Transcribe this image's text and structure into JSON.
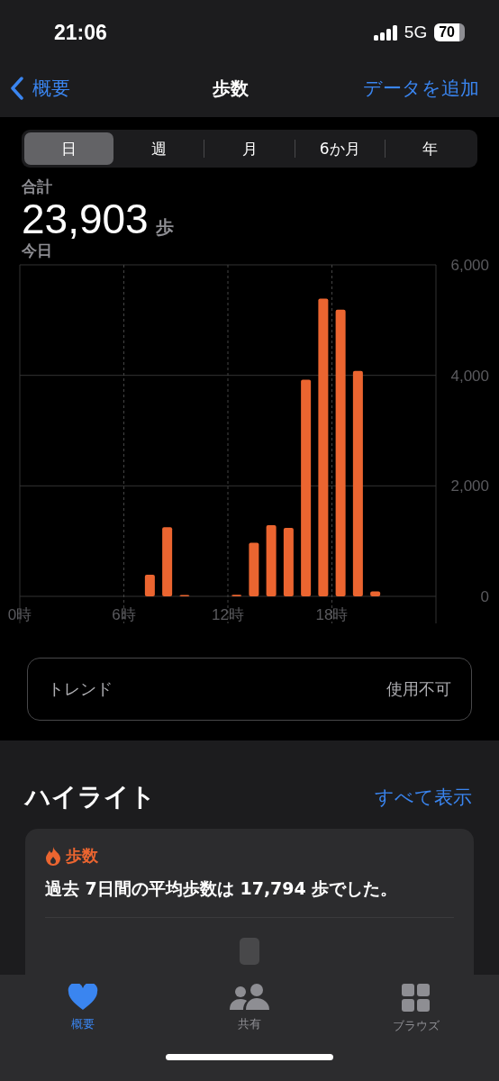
{
  "status_bar": {
    "time": "21:06",
    "network": "5G",
    "battery": "70"
  },
  "nav": {
    "back": "概要",
    "title": "歩数",
    "action": "データを追加"
  },
  "segments": [
    {
      "label": "日",
      "selected": true
    },
    {
      "label": "週",
      "selected": false
    },
    {
      "label": "月",
      "selected": false
    },
    {
      "label": "6か月",
      "selected": false
    },
    {
      "label": "年",
      "selected": false
    }
  ],
  "summary": {
    "label": "合計",
    "value": "23,903",
    "unit": "歩",
    "period": "今日"
  },
  "chart_data": {
    "type": "bar",
    "x": [
      7.5,
      8.5,
      9.5,
      12.5,
      13.5,
      14.5,
      15.5,
      16.5,
      17.5,
      18.5,
      19.5,
      20.5
    ],
    "xlim": [
      0,
      24
    ],
    "grid": true,
    "series": [
      {
        "color": "#eb6530",
        "values": [
          390,
          1250,
          10,
          30,
          970,
          1290,
          1240,
          3920,
          5390,
          5190,
          4080,
          90
        ]
      }
    ],
    "xticks": [
      {
        "value": 0,
        "label": "0時"
      },
      {
        "value": 6,
        "label": "6時"
      },
      {
        "value": 12,
        "label": "12時"
      },
      {
        "value": 18,
        "label": "18時"
      }
    ],
    "ylim": [
      0,
      6000
    ],
    "yticks": [
      {
        "value": 0,
        "label": "0"
      },
      {
        "value": 2000,
        "label": "2,000"
      },
      {
        "value": 4000,
        "label": "4,000"
      },
      {
        "value": 6000,
        "label": "6,000"
      }
    ]
  },
  "trend": {
    "label": "トレンド",
    "value": "使用不可"
  },
  "highlights": {
    "title": "ハイライト",
    "link": "すべて表示",
    "card": {
      "category": "歩数",
      "text": "過去 7日間の平均歩数は 17,794 歩でした。"
    }
  },
  "tab_bar": [
    {
      "label": "概要",
      "selected": true
    },
    {
      "label": "共有",
      "selected": false
    },
    {
      "label": "ブラウズ",
      "selected": false
    }
  ]
}
